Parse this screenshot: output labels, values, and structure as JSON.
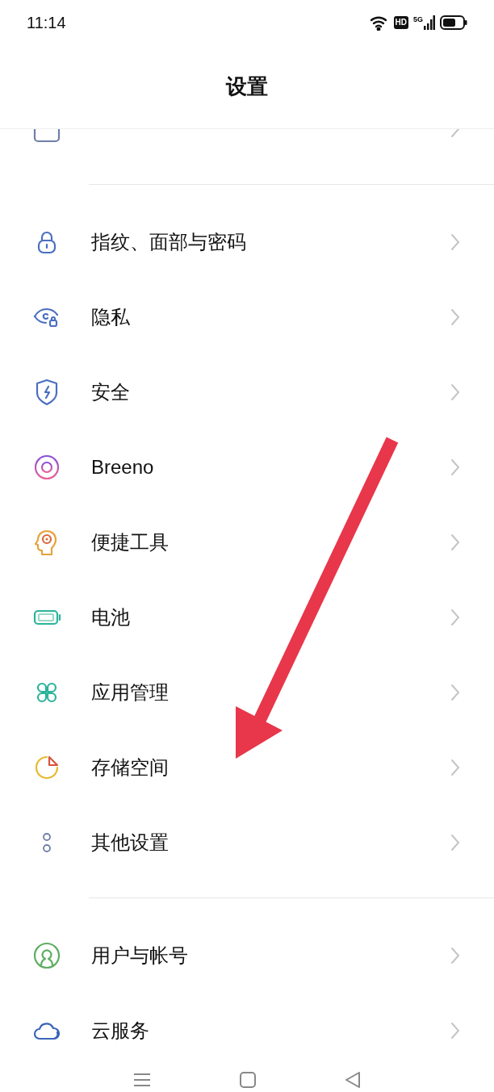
{
  "status_bar": {
    "time": "11:14",
    "hd": "HD",
    "network": "5G"
  },
  "header": {
    "title": "设置"
  },
  "groups": [
    {
      "items": [
        {
          "kind": "lock",
          "label": "指纹、面部与密码"
        },
        {
          "kind": "privacy",
          "label": "隐私"
        },
        {
          "kind": "shield",
          "label": "安全"
        },
        {
          "kind": "ring",
          "label": "Breeno"
        },
        {
          "kind": "head",
          "label": "便捷工具"
        },
        {
          "kind": "battery",
          "label": "电池"
        },
        {
          "kind": "apps",
          "label": "应用管理"
        },
        {
          "kind": "storage",
          "label": "存储空间"
        },
        {
          "kind": "dots",
          "label": "其他设置"
        }
      ]
    },
    {
      "items": [
        {
          "kind": "user",
          "label": "用户与帐号"
        },
        {
          "kind": "cloud",
          "label": "云服务"
        }
      ]
    }
  ]
}
